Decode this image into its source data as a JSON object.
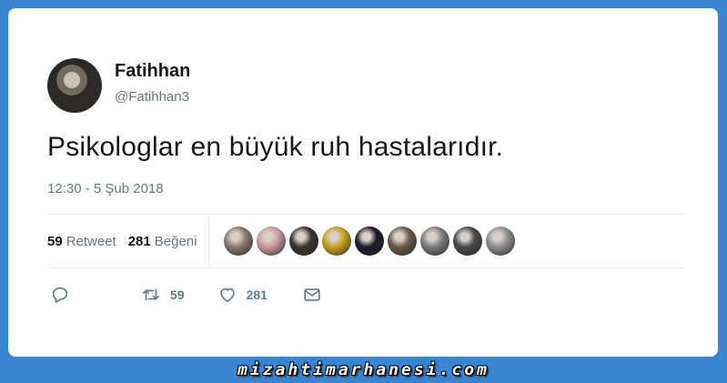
{
  "tweet": {
    "author_name": "Fatihhan",
    "author_handle": "@Fatihhan3",
    "text": "Psikologlar en büyük ruh hastalarıdır.",
    "timestamp": "12:30 - 5 Şub 2018",
    "stats": {
      "retweet_count": "59",
      "retweet_label": "Retweet",
      "like_count": "281",
      "like_label": "Beğeni"
    },
    "liker_avatars": [
      {
        "color": "#8a7a72"
      },
      {
        "color": "#c99aa0"
      },
      {
        "color": "#3a3630"
      },
      {
        "color": "#c8a020"
      },
      {
        "color": "#1d1b2a"
      },
      {
        "color": "#6b5a4a"
      },
      {
        "color": "#7d7d7d"
      },
      {
        "color": "#4a4a4a"
      },
      {
        "color": "#8f8f8f"
      }
    ],
    "actions": {
      "reply_icon": "reply-icon",
      "retweet_icon": "retweet-icon",
      "retweet_count": "59",
      "like_icon": "heart-icon",
      "like_count": "281",
      "dm_icon": "mail-icon"
    }
  },
  "watermark": "mizahtimarhanesi.com",
  "colors": {
    "background": "#3b86d0",
    "text_primary": "#14171a",
    "text_secondary": "#657786"
  }
}
